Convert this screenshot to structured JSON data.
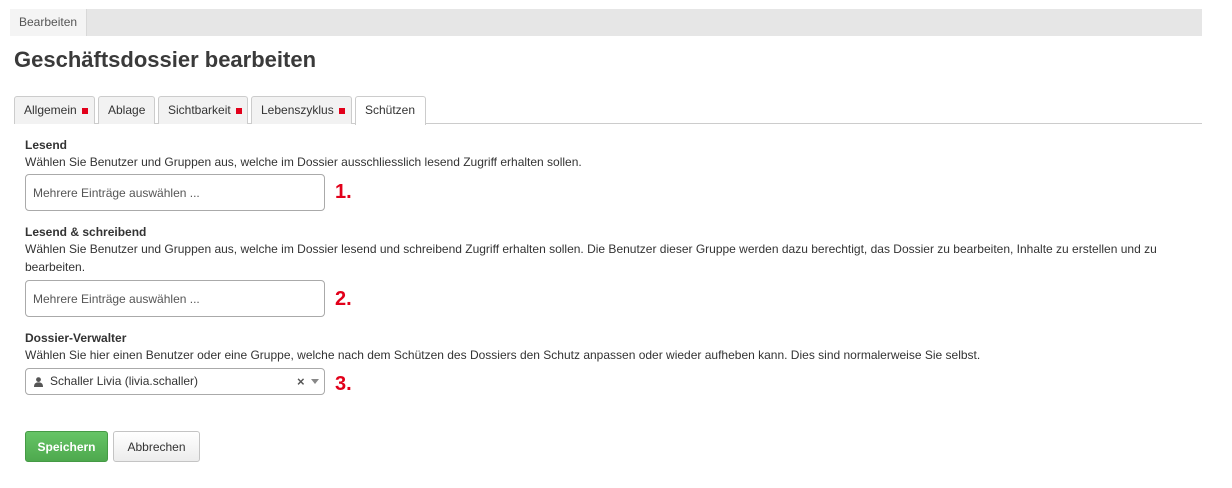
{
  "breadcrumb": {
    "tab_label": "Bearbeiten"
  },
  "page": {
    "title": "Geschäftsdossier bearbeiten"
  },
  "tabs": [
    {
      "label": "Allgemein",
      "has_marker": true
    },
    {
      "label": "Ablage",
      "has_marker": false
    },
    {
      "label": "Sichtbarkeit",
      "has_marker": true
    },
    {
      "label": "Lebenszyklus",
      "has_marker": true
    },
    {
      "label": "Schützen",
      "has_marker": false,
      "active": true
    }
  ],
  "sections": {
    "read": {
      "title": "Lesend",
      "help": "Wählen Sie Benutzer und Gruppen aus, welche im Dossier ausschliesslich lesend Zugriff erhalten sollen.",
      "placeholder": "Mehrere Einträge auswählen ...",
      "annotation": "1."
    },
    "read_write": {
      "title": "Lesend & schreibend",
      "help": "Wählen Sie Benutzer und Gruppen aus, welche im Dossier lesend und schreibend Zugriff erhalten sollen. Die Benutzer dieser Gruppe werden dazu berechtigt, das Dossier zu bearbeiten, Inhalte zu erstellen und zu bearbeiten.",
      "placeholder": "Mehrere Einträge auswählen ...",
      "annotation": "2."
    },
    "manager": {
      "title": "Dossier-Verwalter",
      "help": "Wählen Sie hier einen Benutzer oder eine Gruppe, welche nach dem Schützen des Dossiers den Schutz anpassen oder wieder aufheben kann. Dies sind normalerweise Sie selbst.",
      "selected_value": "Schaller Livia (livia.schaller)",
      "clear_symbol": "×",
      "annotation": "3."
    }
  },
  "buttons": {
    "save": "Speichern",
    "cancel": "Abbrechen"
  },
  "colors": {
    "accent_red": "#e2001a",
    "save_green": "#5cb85c"
  },
  "icons": {
    "user": "user-icon",
    "clear": "clear-icon",
    "dropdown": "chevron-down-icon"
  }
}
